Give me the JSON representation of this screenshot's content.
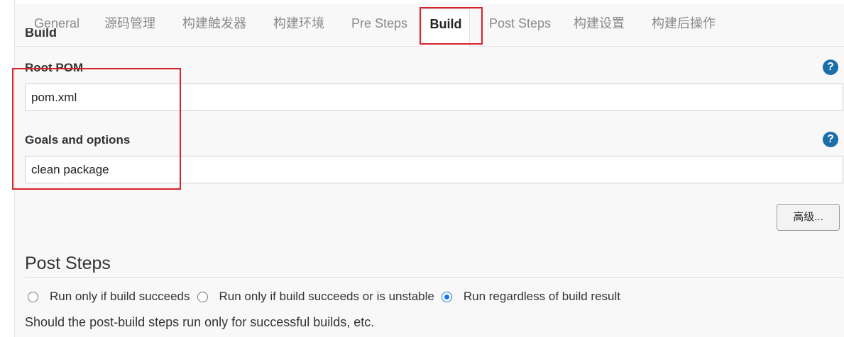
{
  "tabs": [
    {
      "label": "General"
    },
    {
      "label": "源码管理"
    },
    {
      "label": "构建触发器"
    },
    {
      "label": "构建环境"
    },
    {
      "label": "Pre Steps"
    },
    {
      "label": "Build"
    },
    {
      "label": "Post Steps"
    },
    {
      "label": "构建设置"
    },
    {
      "label": "构建后操作"
    }
  ],
  "active_tab": "Build",
  "build": {
    "section_title_partial": "Build",
    "root_pom": {
      "label": "Root POM",
      "value": "pom.xml"
    },
    "goals": {
      "label": "Goals and options",
      "value": "clean package"
    },
    "help_icon": "?",
    "advanced_label": "高级..."
  },
  "post_steps": {
    "title": "Post Steps",
    "options": [
      {
        "label": "Run only if build succeeds",
        "selected": false
      },
      {
        "label": "Run only if build succeeds or is unstable",
        "selected": false
      },
      {
        "label": "Run regardless of build result",
        "selected": true
      }
    ],
    "description": "Should the post-build steps run only for successful builds, etc."
  },
  "colors": {
    "accent": "#1a73e8",
    "highlight": "#d8232a",
    "help": "#1b6ea8"
  }
}
